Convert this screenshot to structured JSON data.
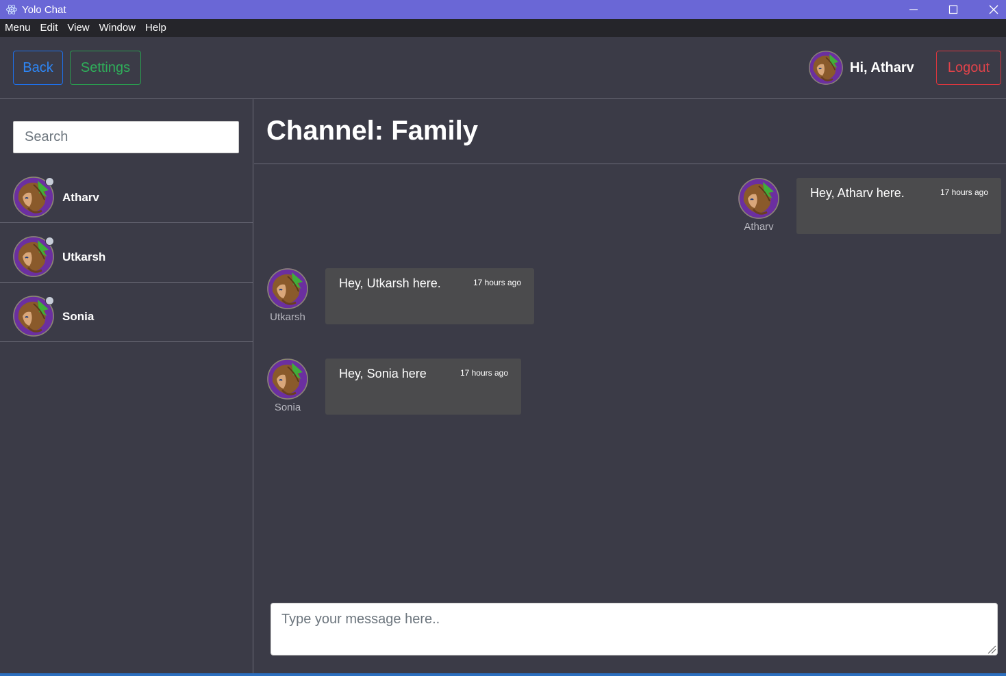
{
  "window": {
    "title": "Yolo Chat",
    "accent": "#6a67d6"
  },
  "menu": [
    "Menu",
    "Edit",
    "View",
    "Window",
    "Help"
  ],
  "header": {
    "back_label": "Back",
    "settings_label": "Settings",
    "greeting": "Hi, Atharv",
    "logout_label": "Logout"
  },
  "sidebar": {
    "search_placeholder": "Search",
    "contacts": [
      {
        "name": "Atharv",
        "status": "offline"
      },
      {
        "name": "Utkarsh",
        "status": "offline"
      },
      {
        "name": "Sonia",
        "status": "offline"
      }
    ]
  },
  "channel": {
    "title": "Channel: Family"
  },
  "messages": [
    {
      "author": "Atharv",
      "text": "Hey, Atharv here.",
      "time": "17 hours ago",
      "own": true
    },
    {
      "author": "Utkarsh",
      "text": "Hey, Utkarsh here.",
      "time": "17 hours ago",
      "own": false
    },
    {
      "author": "Sonia",
      "text": "Hey, Sonia here",
      "time": "17 hours ago",
      "own": false
    }
  ],
  "composer": {
    "placeholder": "Type your message here.."
  },
  "colors": {
    "background": "#3b3b47",
    "back_button": "#2e86f5",
    "settings_button": "#2fae5a",
    "logout_button": "#e0434a",
    "bubble": "#4b4b4d"
  }
}
